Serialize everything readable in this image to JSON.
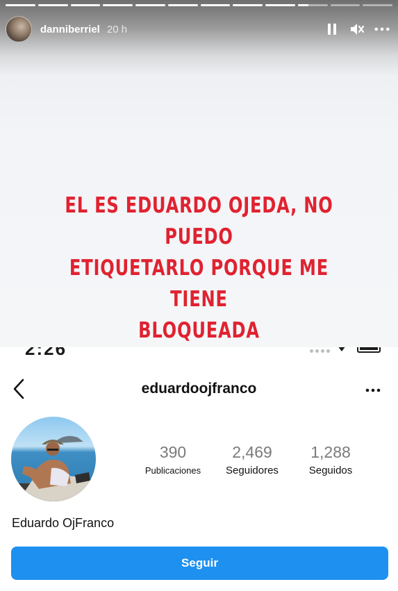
{
  "story": {
    "progress": [
      1,
      1,
      1,
      1,
      1,
      1,
      1,
      1,
      1,
      0.35,
      0,
      0
    ],
    "username": "danniberriel",
    "time_ago": "20 h",
    "controls": [
      "pause-icon",
      "mute-icon",
      "more-icon"
    ],
    "text_lines": [
      "EL ES EDUARDO OJEDA, NO PUEDO",
      "ETIQUETARLO PORQUE ME TIENE",
      "BLOQUEADA"
    ],
    "text_color": "#e02230"
  },
  "status_bar": {
    "time": "2:26"
  },
  "profile": {
    "username": "eduardoojfranco",
    "stats": [
      {
        "value": "390",
        "label": "Publicaciones"
      },
      {
        "value": "2,469",
        "label": "Seguidores"
      },
      {
        "value": "1,288",
        "label": "Seguidos"
      }
    ],
    "display_name": "Eduardo OjFranco",
    "follow_label": "Seguir",
    "follow_color": "#1e90f0"
  }
}
